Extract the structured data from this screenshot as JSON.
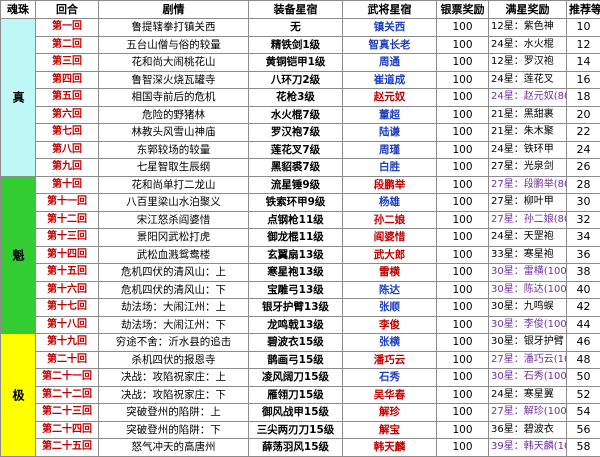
{
  "headers": [
    "魂珠",
    "回合",
    "剧情",
    "装备星宿",
    "武将星宿",
    "银票奖励",
    "满星奖励",
    "推荐等级"
  ],
  "beads": [
    {
      "label": "真",
      "color": "#bff7f7",
      "rows": 9
    },
    {
      "label": "魁",
      "color": "#33cc33",
      "rows": 9
    },
    {
      "label": "极",
      "color": "#ffff00",
      "rows": 7
    }
  ],
  "rows": [
    {
      "chapter": "第一回",
      "plot": "鲁提辖拳打镇关西",
      "equip": "无",
      "star": "镇关西",
      "star_color": "blue",
      "silver": "100",
      "reward": "12星：紫色神",
      "reward_color": "",
      "level": "10"
    },
    {
      "chapter": "第二回",
      "plot": "五台山僧与俗的较量",
      "equip": "精铁剑1级",
      "star": "智真长老",
      "star_color": "blue",
      "silver": "100",
      "reward": "24星：水火棍",
      "reward_color": "",
      "level": "12"
    },
    {
      "chapter": "第三回",
      "plot": "花和尚大闹桃花山",
      "equip": "黄铜铠甲1级",
      "star": "周通",
      "star_color": "blue",
      "silver": "100",
      "reward": "12星：罗汉袍",
      "reward_color": "",
      "level": "14"
    },
    {
      "chapter": "第四回",
      "plot": "鲁智深火烧瓦罐寺",
      "equip": "八环刀2级",
      "star": "崔道成",
      "star_color": "blue",
      "silver": "100",
      "reward": "24星：莲花叉",
      "reward_color": "",
      "level": "16"
    },
    {
      "chapter": "第五回",
      "plot": "相国寺前后的危机",
      "equip": "花枪3级",
      "star": "赵元奴",
      "star_color": "red",
      "silver": "100",
      "reward": "24星：赵元奴(80)",
      "reward_color": "purple",
      "level": "18"
    },
    {
      "chapter": "第六回",
      "plot": "危险的野猪林",
      "equip": "水火棍7级",
      "star": "董超",
      "star_color": "blue",
      "silver": "100",
      "reward": "21星：黑甜裹",
      "reward_color": "",
      "level": "20"
    },
    {
      "chapter": "第七回",
      "plot": "林教头风雪山神庙",
      "equip": "罗汉袍7级",
      "star": "陆谦",
      "star_color": "blue",
      "silver": "100",
      "reward": "21星：朱木聚",
      "reward_color": "",
      "level": "22"
    },
    {
      "chapter": "第八回",
      "plot": "东郭较场的较量",
      "equip": "莲花叉7级",
      "star": "周瑾",
      "star_color": "blue",
      "silver": "100",
      "reward": "24星：铁环甲",
      "reward_color": "",
      "level": "24"
    },
    {
      "chapter": "第九回",
      "plot": "七星智取生辰纲",
      "equip": "黑貂裘7级",
      "star": "白胜",
      "star_color": "blue",
      "silver": "100",
      "reward": "27星：光泉剑",
      "reward_color": "",
      "level": "26"
    },
    {
      "chapter": "第十回",
      "plot": "花和尚单打二龙山",
      "equip": "流星锤9级",
      "star": "段鹏举",
      "star_color": "red",
      "silver": "100",
      "reward": "27星：段鹏举(80)",
      "reward_color": "purple",
      "level": "28"
    },
    {
      "chapter": "第十一回",
      "plot": "八百里梁山水泊聚义",
      "equip": "铁索环甲9级",
      "star": "杨雄",
      "star_color": "blue",
      "silver": "100",
      "reward": "27星：柳叶甲",
      "reward_color": "",
      "level": "30"
    },
    {
      "chapter": "第十二回",
      "plot": "宋江怒杀阎婆惜",
      "equip": "点钢枪11级",
      "star": "孙二娘",
      "star_color": "red",
      "silver": "100",
      "reward": "27星：孙二娘(80)",
      "reward_color": "purple",
      "level": "32"
    },
    {
      "chapter": "第十三回",
      "plot": "景阳冈武松打虎",
      "equip": "御龙棍11级",
      "star": "阎婆惜",
      "star_color": "red",
      "silver": "100",
      "reward": "24星：天罡袍",
      "reward_color": "",
      "level": "34"
    },
    {
      "chapter": "第十四回",
      "plot": "武松血溅鸳鸯楼",
      "equip": "玄翼扇13级",
      "star": "武大郎",
      "star_color": "red",
      "silver": "100",
      "reward": "33星：寒星袍",
      "reward_color": "",
      "level": "36"
    },
    {
      "chapter": "第十五回",
      "plot": "危机四伏的清风山：上",
      "equip": "寒星袍13级",
      "star": "雷横",
      "star_color": "red",
      "silver": "100",
      "reward": "30星：雷横(100)",
      "reward_color": "purple",
      "level": "38"
    },
    {
      "chapter": "第十六回",
      "plot": "危机四伏的清风山：下",
      "equip": "宝雕弓13级",
      "star": "陈达",
      "star_color": "blue",
      "silver": "100",
      "reward": "30星：陈达(100)",
      "reward_color": "purple",
      "level": "40"
    },
    {
      "chapter": "第十七回",
      "plot": "劫法场：大闹江州：上",
      "equip": "银牙护臂13级",
      "star": "张顺",
      "star_color": "blue",
      "silver": "100",
      "reward": "30星：九鸣蜈",
      "reward_color": "",
      "level": "42"
    },
    {
      "chapter": "第十八回",
      "plot": "劫法场：大闹江州：下",
      "equip": "龙鸣戟13级",
      "star": "李俊",
      "star_color": "red",
      "silver": "100",
      "reward": "30星：李俊(100)",
      "reward_color": "purple",
      "level": "44"
    },
    {
      "chapter": "第十九回",
      "plot": "穷途不舍：沂水县的追击",
      "equip": "碧波衣15级",
      "star": "张横",
      "star_color": "blue",
      "silver": "100",
      "reward": "30星：银牙护臂",
      "reward_color": "",
      "level": "46"
    },
    {
      "chapter": "第二十回",
      "plot": "杀机四伏的报恩寺",
      "equip": "鹊画弓15级",
      "star": "潘巧云",
      "star_color": "red",
      "silver": "100",
      "reward": "27星：潘巧云(100)",
      "reward_color": "purple",
      "level": "48"
    },
    {
      "chapter": "第二十一回",
      "plot": "决战：攻陷祝家庄：上",
      "equip": "凌风阔刀15级",
      "star": "石秀",
      "star_color": "blue",
      "silver": "100",
      "reward": "30星：石秀(100)",
      "reward_color": "purple",
      "level": "50"
    },
    {
      "chapter": "第二十二回",
      "plot": "决战：攻陷祝家庄：下",
      "equip": "雁翎刀15级",
      "star": "吴华春",
      "star_color": "red",
      "silver": "100",
      "reward": "24星：寒星翼",
      "reward_color": "",
      "level": "52"
    },
    {
      "chapter": "第二十三回",
      "plot": "突破登州的陷阱：上",
      "equip": "御风战甲15级",
      "star": "解珍",
      "star_color": "red",
      "silver": "100",
      "reward": "27星：解珍(100)",
      "reward_color": "purple",
      "level": "54"
    },
    {
      "chapter": "第二十四回",
      "plot": "突破登州的陷阱：下",
      "equip": "三尖两刃刀15级",
      "star": "解宝",
      "star_color": "red",
      "silver": "100",
      "reward": "36星：碧波衣",
      "reward_color": "",
      "level": "56"
    },
    {
      "chapter": "第二十五回",
      "plot": "怒气冲天的高唐州",
      "equip": "薛荡羽风15级",
      "star": "韩天麟",
      "star_color": "red",
      "silver": "100",
      "reward": "39星：韩天麟(100)",
      "reward_color": "purple",
      "level": "58"
    }
  ]
}
